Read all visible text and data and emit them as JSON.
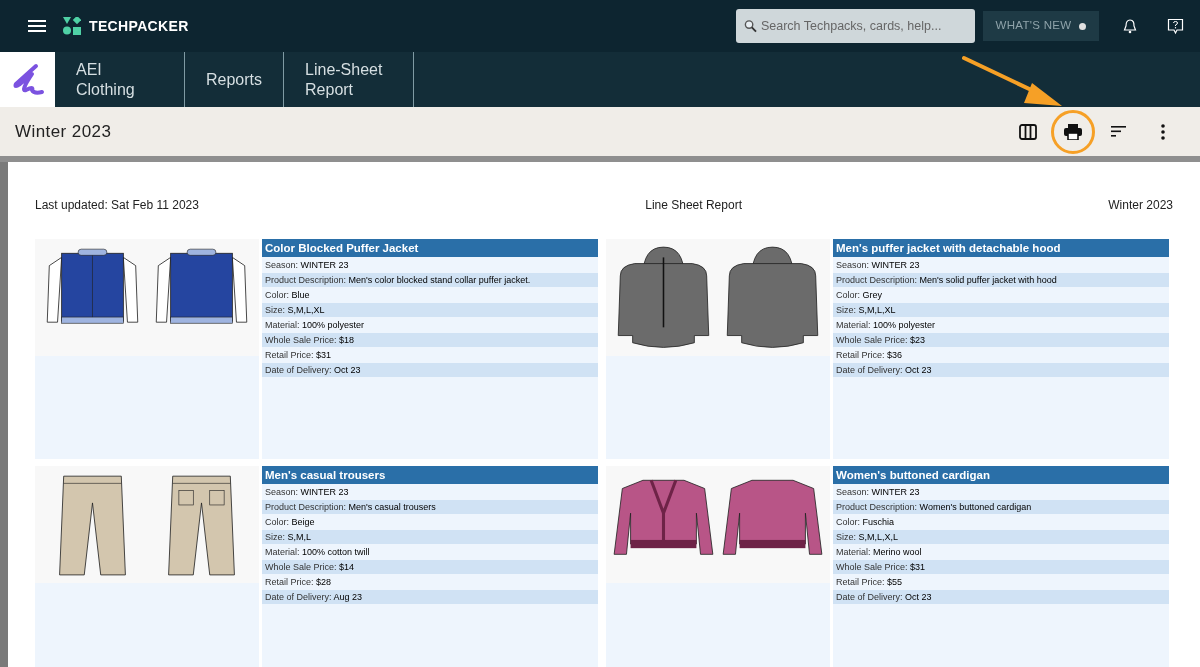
{
  "app": {
    "name": "TECHPACKER"
  },
  "search": {
    "placeholder": "Search Techpacks, cards, help..."
  },
  "whats_new": {
    "label": "WHAT'S NEW",
    "unread": true
  },
  "breadcrumbs": [
    "AEI Clothing",
    "Reports",
    "Line-Sheet Report"
  ],
  "toolbar": {
    "title": "Winter 2023",
    "tools": [
      {
        "kind": "columns",
        "highlighted": false
      },
      {
        "kind": "print",
        "highlighted": true
      },
      {
        "kind": "sort",
        "highlighted": false
      },
      {
        "kind": "more",
        "highlighted": false
      }
    ]
  },
  "report": {
    "updated": "Last updated: Sat Feb 11 2023",
    "title": "Line Sheet Report",
    "season": "Winter 2023"
  },
  "products": [
    {
      "title": "Color Blocked Puffer Jacket",
      "kind": "varsity",
      "color": "#2545a0",
      "fields": [
        [
          "Season:",
          "WINTER 23"
        ],
        [
          "Product Description:",
          "Men's color blocked stand collar puffer jacket."
        ],
        [
          "Color:",
          "Blue"
        ],
        [
          "Size:",
          "S,M,L,XL"
        ],
        [
          "Material:",
          "100% polyester"
        ],
        [
          "Whole Sale Price:",
          "$18"
        ],
        [
          "Retail Price:",
          "$31"
        ],
        [
          "Date of Delivery:",
          "Oct 23"
        ]
      ]
    },
    {
      "title": "Men's puffer jacket with detachable hood",
      "kind": "hooded",
      "color": "#6b6b6b",
      "fields": [
        [
          "Season:",
          "WINTER 23"
        ],
        [
          "Product Description:",
          "Men's solid puffer jacket with hood"
        ],
        [
          "Color:",
          "Grey"
        ],
        [
          "Size:",
          "S,M,L,XL"
        ],
        [
          "Material:",
          "100% polyester"
        ],
        [
          "Whole Sale Price:",
          "$23"
        ],
        [
          "Retail Price:",
          "$36"
        ],
        [
          "Date of Delivery:",
          "Oct 23"
        ]
      ]
    },
    {
      "title": "Men's casual trousers",
      "kind": "trousers",
      "color": "#d3c6ae",
      "fields": [
        [
          "Season:",
          "WINTER 23"
        ],
        [
          "Product Description:",
          "Men's casual trousers"
        ],
        [
          "Color:",
          "Beige"
        ],
        [
          "Size:",
          "S,M,L"
        ],
        [
          "Material:",
          "100% cotton twill"
        ],
        [
          "Whole Sale Price:",
          "$14"
        ],
        [
          "Retail Price:",
          "$28"
        ],
        [
          "Date of Delivery:",
          "Aug 23"
        ]
      ]
    },
    {
      "title": "Women's buttoned cardigan",
      "kind": "cardigan",
      "color": "#b85587",
      "fields": [
        [
          "Season:",
          "WINTER 23"
        ],
        [
          "Product Description:",
          "Women's buttoned cardigan"
        ],
        [
          "Color:",
          "Fuschia"
        ],
        [
          "Size:",
          "S,M,L,X,L"
        ],
        [
          "Material:",
          "Merino wool"
        ],
        [
          "Whole Sale Price:",
          "$31"
        ],
        [
          "Retail Price:",
          "$55"
        ],
        [
          "Date of Delivery:",
          "Oct 23"
        ]
      ]
    }
  ]
}
